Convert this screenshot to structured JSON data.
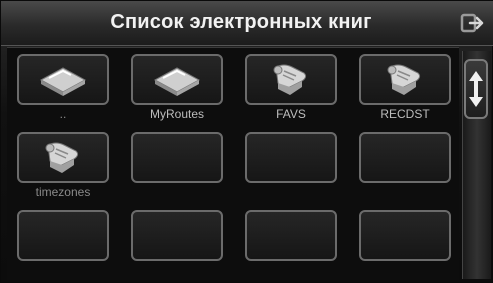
{
  "window": {
    "title": "Список электронных книг",
    "exit_icon": "exit-icon"
  },
  "grid": {
    "tiles": [
      {
        "label": "..",
        "icon": "folder-icon"
      },
      {
        "label": "MyRoutes",
        "icon": "folder-icon"
      },
      {
        "label": "FAVS",
        "icon": "book-scroll-icon"
      },
      {
        "label": "RECDST",
        "icon": "book-scroll-icon"
      },
      {
        "label": "timezones",
        "icon": "book-scroll-icon"
      },
      {
        "label": "",
        "icon": ""
      },
      {
        "label": "",
        "icon": ""
      },
      {
        "label": "",
        "icon": ""
      },
      {
        "label": "",
        "icon": ""
      },
      {
        "label": "",
        "icon": ""
      },
      {
        "label": "",
        "icon": ""
      },
      {
        "label": "",
        "icon": ""
      }
    ]
  },
  "scrollbar": {
    "icon": "up-down-arrow-icon"
  },
  "colors": {
    "background": "#111111",
    "tile_border": "#6b6b6b",
    "title_text": "#f2f2f2",
    "label_text": "#bdbdbd"
  }
}
